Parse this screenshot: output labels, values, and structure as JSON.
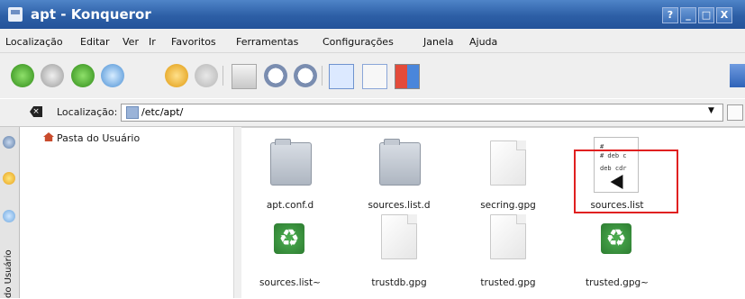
{
  "window": {
    "title": "apt - Konqueror",
    "controls": [
      "?",
      "_",
      "□",
      "X"
    ]
  },
  "menubar": {
    "items": [
      "Localização",
      "Editar",
      "Ver",
      "Ir",
      "Favoritos",
      "Ferramentas",
      "Configurações",
      "Janela",
      "Ajuda"
    ]
  },
  "toolbar": {
    "buttons": [
      "back-icon",
      "forward-icon",
      "up-icon",
      "home-icon",
      "reload-icon",
      "stop-icon",
      "print-icon",
      "zoom-in-icon",
      "zoom-out-icon",
      "icon-view-icon",
      "detail-view-icon",
      "split-view-icon"
    ]
  },
  "location": {
    "label": "Localização:",
    "value": "/etc/apt/"
  },
  "sidebar": {
    "tree_item": "Pasta do Usuário",
    "vertical_label": "do Usuário"
  },
  "files": [
    {
      "name": "apt.conf.d",
      "type": "folder"
    },
    {
      "name": "sources.list.d",
      "type": "folder"
    },
    {
      "name": "secring.gpg",
      "type": "document"
    },
    {
      "name": "sources.list",
      "type": "text",
      "preview": [
        "#",
        "# deb c",
        "deb cdr"
      ]
    },
    {
      "name": "sources.list~",
      "type": "recycle"
    },
    {
      "name": "trustdb.gpg",
      "type": "document"
    },
    {
      "name": "trusted.gpg",
      "type": "document"
    },
    {
      "name": "trusted.gpg~",
      "type": "recycle"
    }
  ],
  "colors": {
    "titlebar": "#2d5fa6",
    "highlight": "#e02020"
  }
}
